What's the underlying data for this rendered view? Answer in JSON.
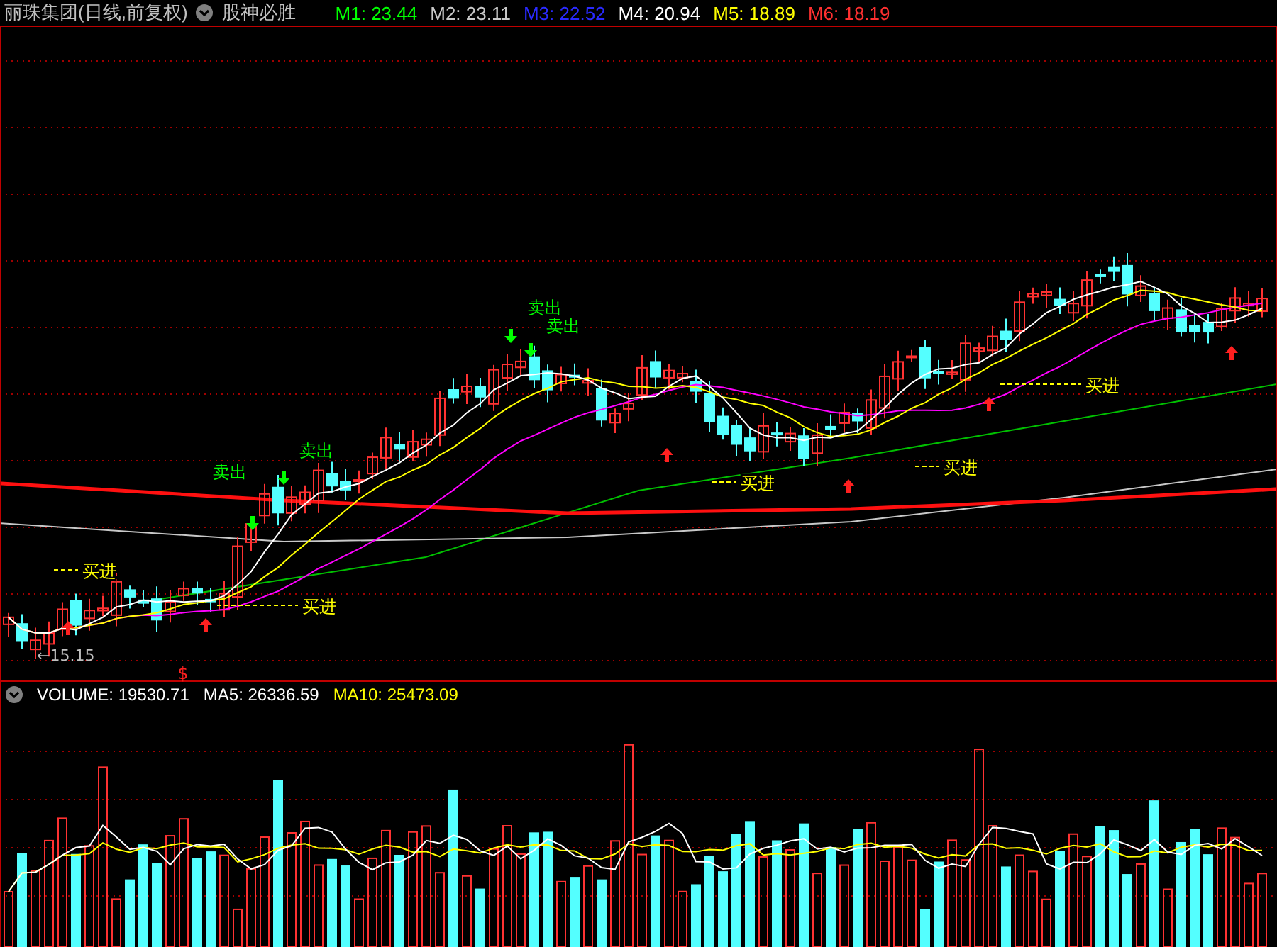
{
  "header": {
    "title": "丽珠集团(日线,前复权)",
    "indicator": "股神必胜",
    "legend": [
      {
        "text": "M1: 23.44",
        "color": "#00ff00"
      },
      {
        "text": "M2: 23.11",
        "color": "#c8c8c8"
      },
      {
        "text": "M3: 22.52",
        "color": "#2a2aff"
      },
      {
        "text": "M4: 20.94",
        "color": "#ffffff"
      },
      {
        "text": "M5: 18.89",
        "color": "#ffff00"
      },
      {
        "text": "M6: 18.19",
        "color": "#ff3030"
      }
    ]
  },
  "price_chart": {
    "signals": [
      {
        "kind": "sell",
        "label": "卖出"
      },
      {
        "kind": "sell",
        "label": "卖出"
      },
      {
        "kind": "sell",
        "label": "卖出"
      },
      {
        "kind": "sell",
        "label": "卖出"
      },
      {
        "kind": "buy",
        "label": "买进"
      },
      {
        "kind": "buy",
        "label": "买进"
      },
      {
        "kind": "buy",
        "label": "买进"
      },
      {
        "kind": "buy",
        "label": "买进"
      },
      {
        "kind": "buy",
        "label": "买进"
      }
    ],
    "low_mark": "←15.15",
    "marker": "$"
  },
  "volume_panel": {
    "legend": [
      {
        "text": "VOLUME: 19530.71",
        "color": "#ffffff"
      },
      {
        "text": "MA5: 26336.59",
        "color": "#ffffff"
      },
      {
        "text": "MA10: 25473.09",
        "color": "#ffff00"
      }
    ]
  }
}
